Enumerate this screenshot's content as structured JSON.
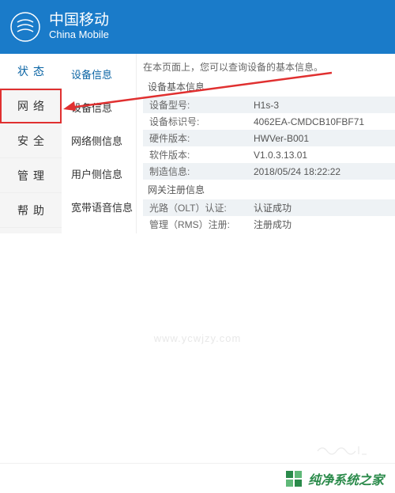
{
  "header": {
    "brand_cn": "中国移动",
    "brand_en": "China Mobile"
  },
  "sidebar": {
    "items": [
      {
        "label": "状态"
      },
      {
        "label": "网络"
      },
      {
        "label": "安全"
      },
      {
        "label": "管理"
      },
      {
        "label": "帮助"
      }
    ]
  },
  "subnav": {
    "items": [
      {
        "label": "设备信息"
      },
      {
        "label": "设备信息"
      },
      {
        "label": "网络侧信息"
      },
      {
        "label": "用户侧信息"
      },
      {
        "label": "宽带语音信息"
      }
    ]
  },
  "content": {
    "desc": "在本页面上，您可以查询设备的基本信息。",
    "section1_title": "设备基本信息",
    "section2_title": "网关注册信息",
    "basic": [
      {
        "label": "设备型号:",
        "value": "H1s-3"
      },
      {
        "label": "设备标识号:",
        "value": "4062EA-CMDCB10FBF71"
      },
      {
        "label": "硬件版本:",
        "value": "HWVer-B001"
      },
      {
        "label": "软件版本:",
        "value": "V1.0.3.13.01"
      },
      {
        "label": "制造信息:",
        "value": "2018/05/24 18:22:22"
      }
    ],
    "register": [
      {
        "label": "光路（OLT）认证:",
        "value": "认证成功"
      },
      {
        "label": "管理（RMS）注册:",
        "value": "注册成功"
      }
    ]
  },
  "watermark": "www.ycwjzy.com",
  "footer": {
    "text": "纯净系统之家"
  }
}
